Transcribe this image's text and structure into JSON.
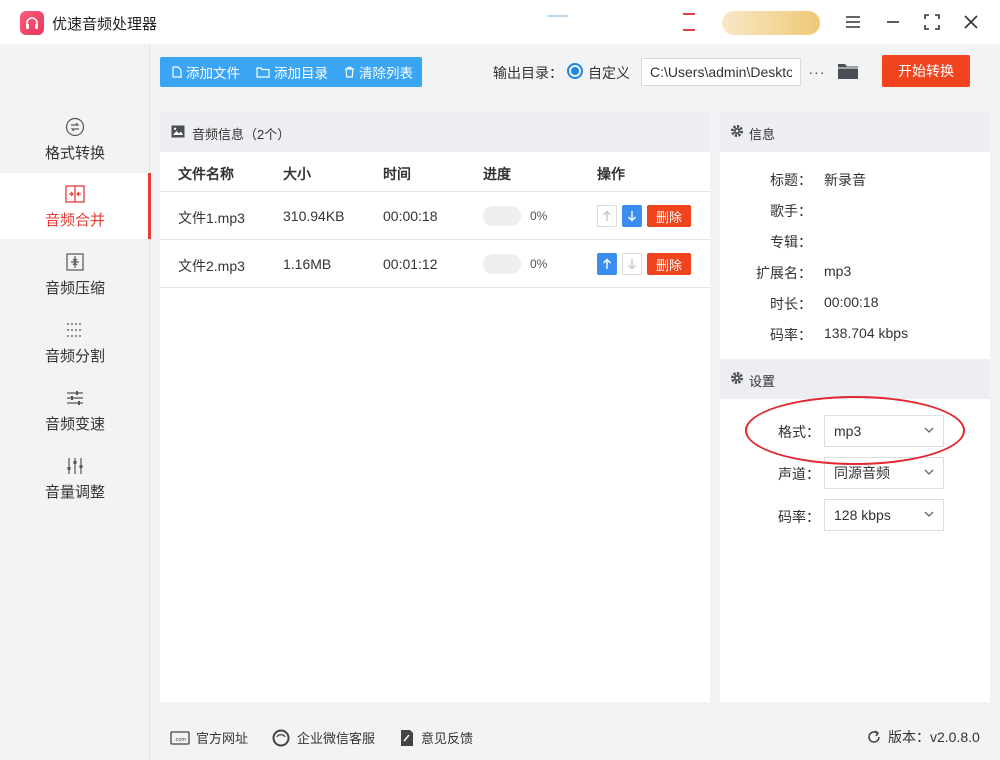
{
  "app": {
    "title": "优速音频处理器"
  },
  "sidebar": {
    "items": [
      {
        "label": "格式转换",
        "icon": "format-convert-icon"
      },
      {
        "label": "音频合并",
        "icon": "merge-icon",
        "active": true
      },
      {
        "label": "音频压缩",
        "icon": "compress-icon"
      },
      {
        "label": "音频分割",
        "icon": "split-icon"
      },
      {
        "label": "音频变速",
        "icon": "speed-icon"
      },
      {
        "label": "音量调整",
        "icon": "volume-sliders-icon"
      }
    ]
  },
  "toolbar": {
    "add_file": "添加文件",
    "add_dir": "添加目录",
    "clear_list": "清除列表",
    "output_label": "输出目录：",
    "custom_label": "自定义",
    "output_path": "C:\\Users\\admin\\Deskto",
    "more": "···",
    "start": "开始转换",
    "accent": "#3aa4f5",
    "start_color": "#f0431e"
  },
  "file_panel": {
    "title": "音频信息（2个）",
    "columns": [
      "文件名称",
      "大小",
      "时间",
      "进度",
      "操作"
    ],
    "rows": [
      {
        "name": "文件1.mp3",
        "size": "310.94KB",
        "time": "00:00:18",
        "progress": "0%",
        "up_enabled": false,
        "down_enabled": true,
        "delete": "删除"
      },
      {
        "name": "文件2.mp3",
        "size": "1.16MB",
        "time": "00:01:12",
        "progress": "0%",
        "up_enabled": true,
        "down_enabled": false,
        "delete": "删除"
      }
    ]
  },
  "info": {
    "title": "信息",
    "fields": [
      {
        "label": "标题：",
        "value": "新录音"
      },
      {
        "label": "歌手：",
        "value": ""
      },
      {
        "label": "专辑：",
        "value": ""
      },
      {
        "label": "扩展名：",
        "value": "mp3"
      },
      {
        "label": "时长：",
        "value": "00:00:18"
      },
      {
        "label": "码率：",
        "value": "138.704 kbps"
      }
    ]
  },
  "settings": {
    "title": "设置",
    "format_label": "格式：",
    "format_value": "mp3",
    "channel_label": "声道：",
    "channel_value": "同源音频",
    "bitrate_label": "码率：",
    "bitrate_value": "128 kbps"
  },
  "footer": {
    "website": "官方网址",
    "wechat": "企业微信客服",
    "feedback": "意见反馈",
    "version": "版本：v2.0.8.0"
  }
}
